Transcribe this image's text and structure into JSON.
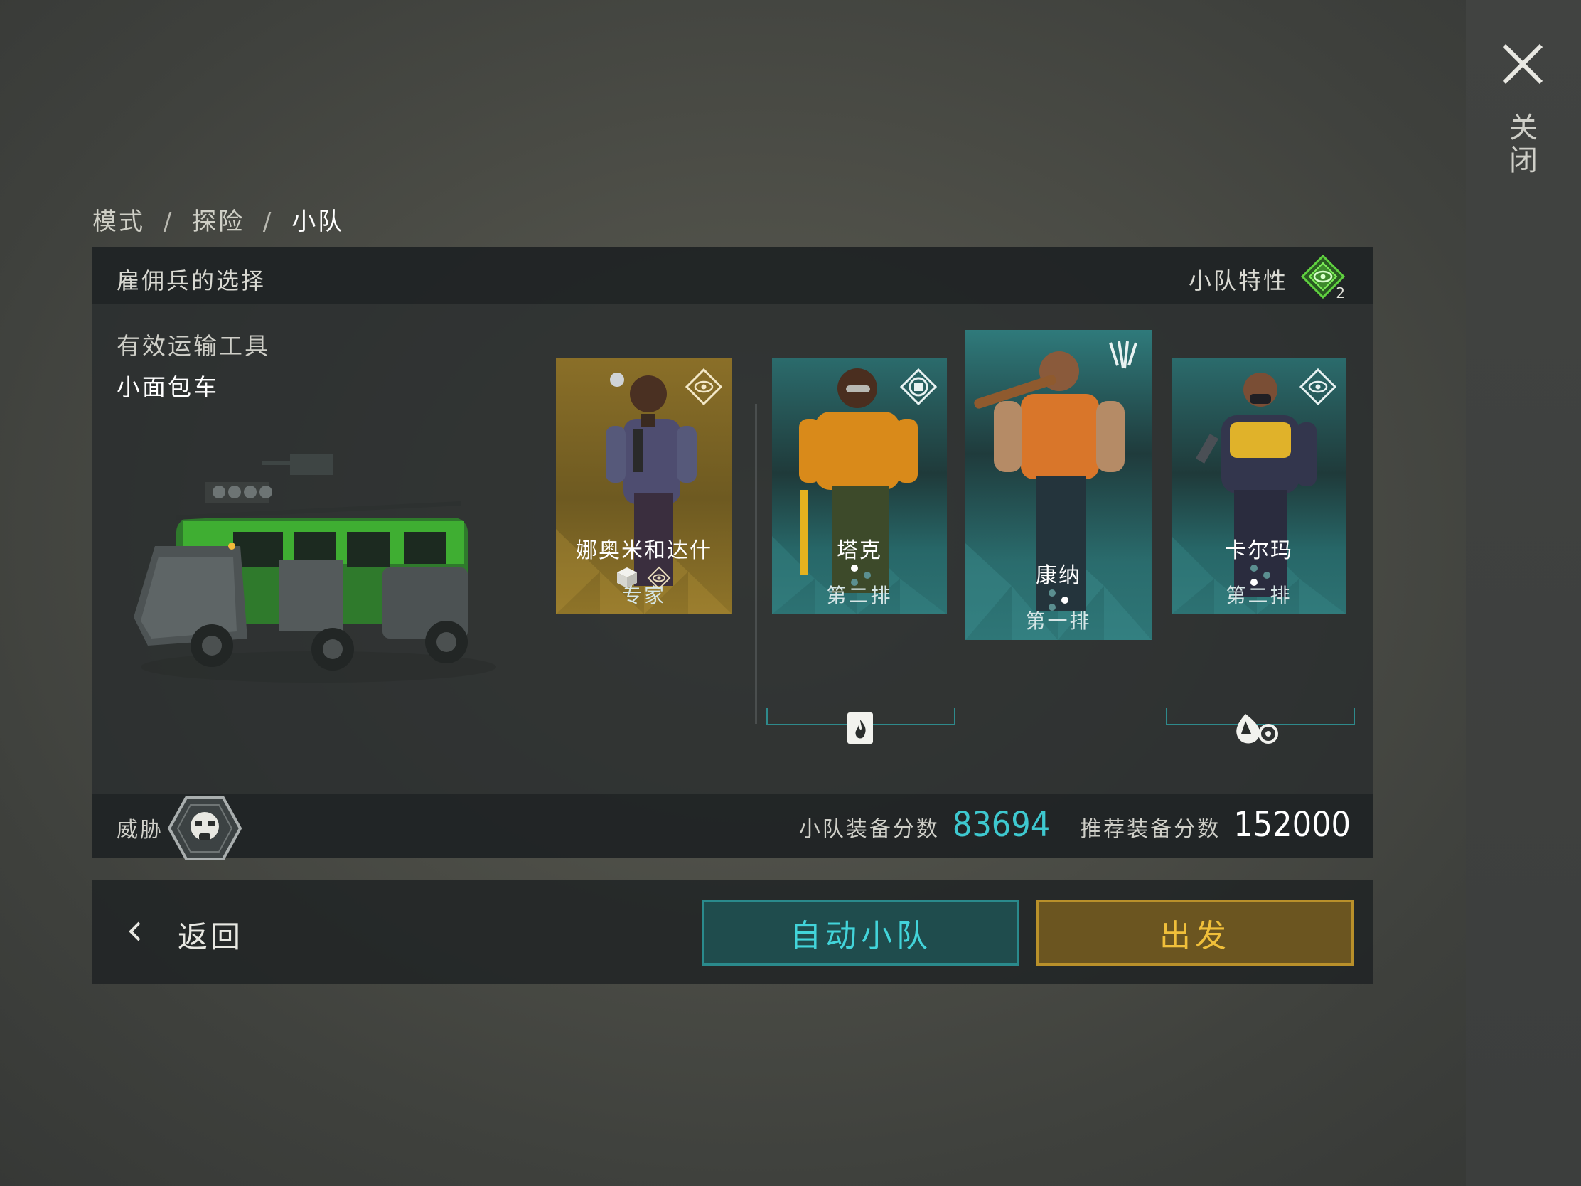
{
  "close": {
    "label": "关闭",
    "icon": "close-icon"
  },
  "breadcrumb": [
    "模式",
    "探险",
    "小队"
  ],
  "breadcrumb_sep": "/",
  "panel": {
    "title": "雇佣兵的选择",
    "trait_label": "小队特性",
    "trait_count": "2",
    "transport_label": "有效运输工具",
    "transport_value": "小面包车"
  },
  "mercs": [
    {
      "name": "娜奥米和达什",
      "row": "专家",
      "theme": "gold"
    },
    {
      "name": "塔克",
      "row": "第二排",
      "theme": "teal"
    },
    {
      "name": "康纳",
      "row": "第一排",
      "theme": "teal"
    },
    {
      "name": "卡尔玛",
      "row": "第二排",
      "theme": "teal"
    }
  ],
  "footer": {
    "threat_label": "威胁",
    "score_label": "小队装备分数",
    "score_value": "83694",
    "rec_label": "推荐装备分数",
    "rec_value": "152000"
  },
  "bottom": {
    "back_label": "返回",
    "auto_label": "自动小队",
    "go_label": "出发"
  },
  "colors": {
    "teal_accent": "#3ec8cf",
    "gold_accent": "#f0bf3a",
    "card_gold": "#8f7429",
    "card_teal": "#2b6b6c",
    "trait_green": "#5fd13f"
  }
}
